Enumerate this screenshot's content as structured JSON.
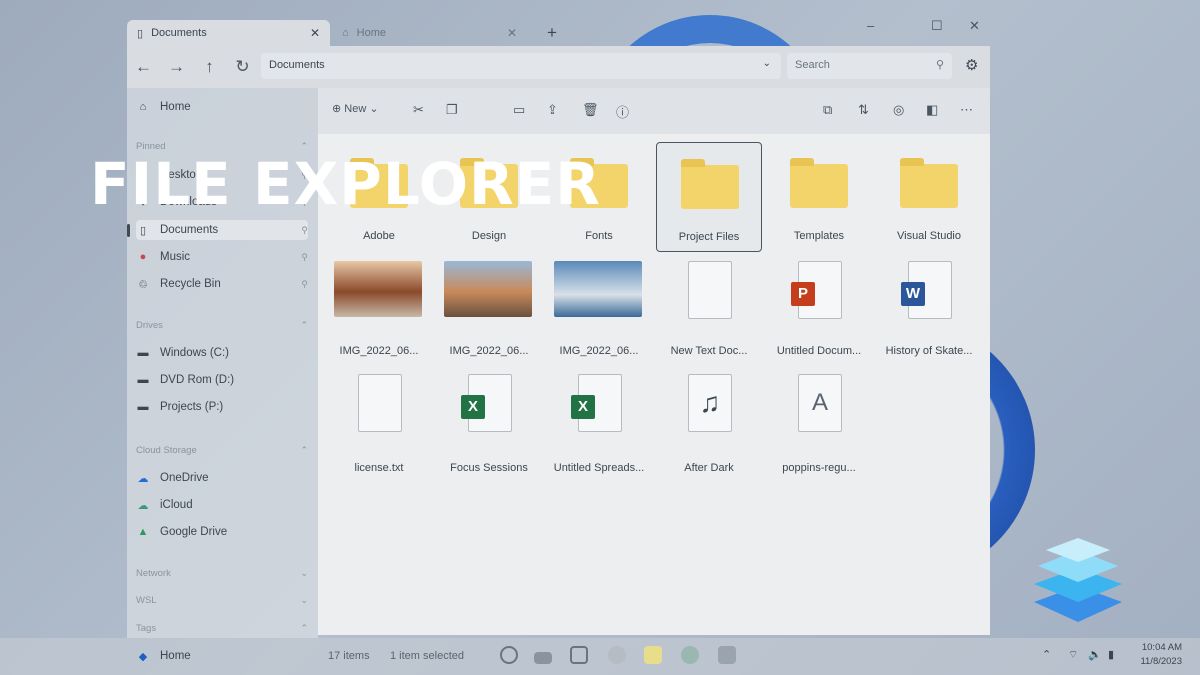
{
  "overlay_title": "FILE EXPLORER",
  "tabs": [
    {
      "label": "Documents",
      "icon": "document-icon"
    },
    {
      "label": "Home",
      "icon": "home-icon"
    }
  ],
  "address": "Documents",
  "search_placeholder": "Search",
  "toolbar": {
    "new_label": "New"
  },
  "sidebar": {
    "home": "Home",
    "pinned_header": "Pinned",
    "pinned": [
      "Desktop",
      "Downloads",
      "Documents",
      "Music",
      "Recycle Bin"
    ],
    "drives_header": "Drives",
    "drives": [
      "Windows (C:)",
      "DVD Rom (D:)",
      "Projects (P:)"
    ],
    "cloud_header": "Cloud Storage",
    "cloud": [
      "OneDrive",
      "iCloud",
      "Google Drive"
    ],
    "network_header": "Network",
    "wsl_header": "WSL",
    "tags_header": "Tags",
    "tags": [
      "Home"
    ]
  },
  "files": [
    {
      "name": "Adobe",
      "type": "folder"
    },
    {
      "name": "Design",
      "type": "folder"
    },
    {
      "name": "Fonts",
      "type": "folder"
    },
    {
      "name": "Project Files",
      "type": "folder",
      "selected": true
    },
    {
      "name": "Templates",
      "type": "folder"
    },
    {
      "name": "Visual Studio",
      "type": "folder"
    },
    {
      "name": "IMG_2022_06...",
      "type": "image"
    },
    {
      "name": "IMG_2022_06...",
      "type": "image"
    },
    {
      "name": "IMG_2022_06...",
      "type": "image"
    },
    {
      "name": "New Text Doc...",
      "type": "text"
    },
    {
      "name": "Untitled Docum...",
      "type": "powerpoint"
    },
    {
      "name": "History of Skate...",
      "type": "word"
    },
    {
      "name": "license.txt",
      "type": "text"
    },
    {
      "name": "Focus Sessions",
      "type": "excel"
    },
    {
      "name": "Untitled Spreads...",
      "type": "excel"
    },
    {
      "name": "After Dark",
      "type": "audio"
    },
    {
      "name": "poppins-regu...",
      "type": "font"
    }
  ],
  "status": {
    "count": "17 items",
    "selection": "1 item selected"
  },
  "clock": {
    "time": "10:04 AM",
    "date": "11/8/2023"
  },
  "colors": {
    "folder": "#f2d46b",
    "word": "#2b579a",
    "excel": "#217346",
    "powerpoint": "#c43e1c",
    "accent": "#1f6fd6"
  }
}
